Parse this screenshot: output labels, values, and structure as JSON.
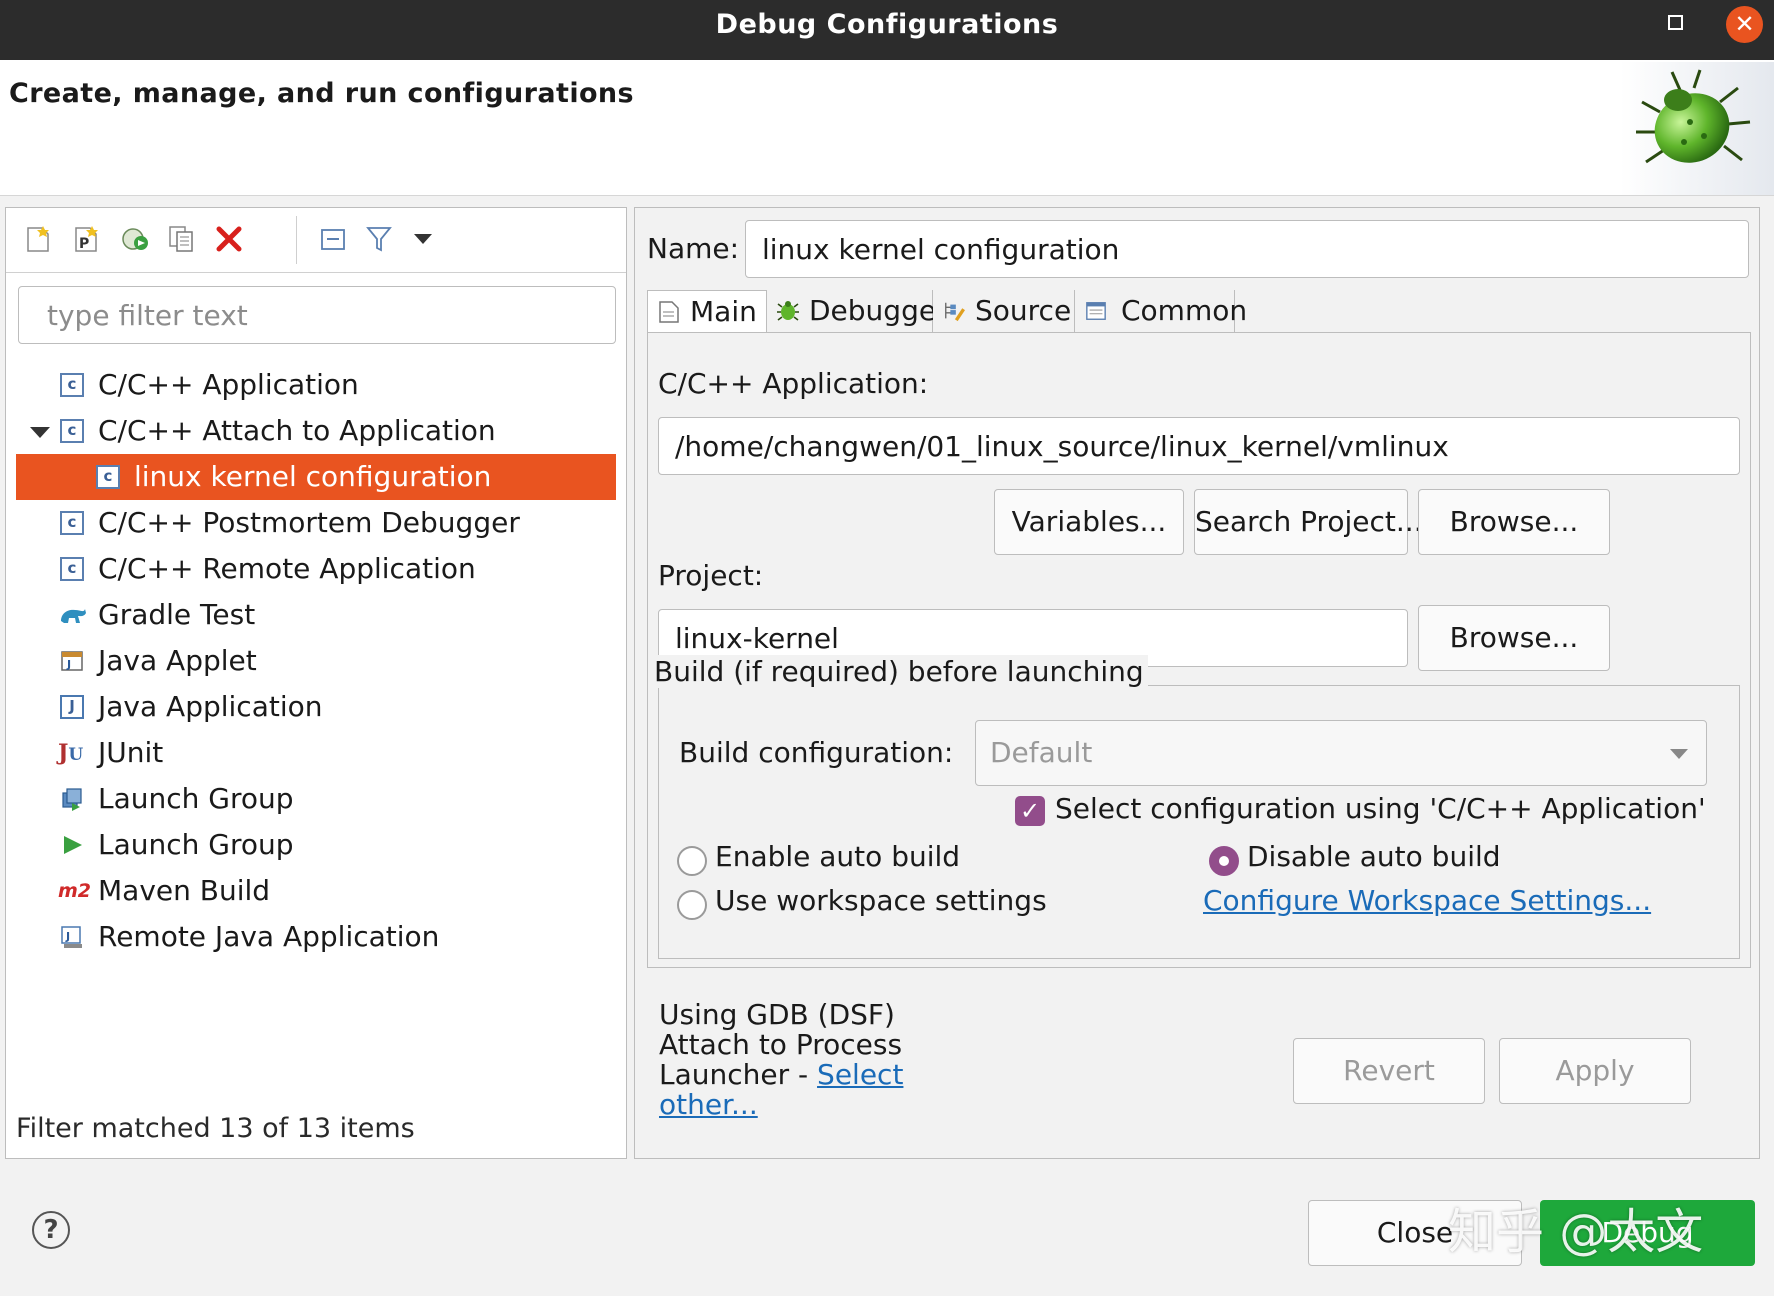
{
  "window": {
    "title": "Debug Configurations",
    "maximize_icon": "maximize-icon",
    "close_icon": "close-icon"
  },
  "header": {
    "heading": "Create, manage, and run configurations",
    "banner_icon": "bug-icon"
  },
  "toolbar": {
    "buttons": [
      "new-configuration-icon",
      "new-prototype-icon",
      "export-icon",
      "duplicate-icon",
      "delete-icon",
      "collapse-all-icon",
      "filter-icon",
      "view-menu-icon"
    ]
  },
  "filter": {
    "placeholder": "type filter text",
    "value": ""
  },
  "tree": {
    "items": [
      {
        "label": "C/C++ Application",
        "icon": "cpp-app-icon"
      },
      {
        "label": "C/C++ Attach to Application",
        "icon": "cpp-app-icon",
        "expanded": true
      },
      {
        "label": "linux kernel configuration",
        "icon": "cpp-app-icon",
        "selected": true
      },
      {
        "label": "C/C++ Postmortem Debugger",
        "icon": "cpp-app-icon"
      },
      {
        "label": "C/C++ Remote Application",
        "icon": "cpp-app-icon"
      },
      {
        "label": "Gradle Test",
        "icon": "gradle-icon"
      },
      {
        "label": "Java Applet",
        "icon": "java-applet-icon"
      },
      {
        "label": "Java Application",
        "icon": "java-app-icon"
      },
      {
        "label": "JUnit",
        "icon": "junit-icon"
      },
      {
        "label": "Launch Group",
        "icon": "launch-group-icon"
      },
      {
        "label": "Launch Group",
        "icon": "launch-group-play-icon"
      },
      {
        "label": "Maven Build",
        "icon": "maven-icon"
      },
      {
        "label": "Remote Java Application",
        "icon": "remote-java-icon"
      }
    ]
  },
  "status": {
    "filter_text": "Filter matched 13 of 13 items"
  },
  "config": {
    "name_label": "Name:",
    "name_value": "linux kernel configuration",
    "tabs": [
      {
        "label": "Main",
        "icon": "main-tab-icon",
        "active": true
      },
      {
        "label": "Debugger",
        "icon": "debugger-tab-icon"
      },
      {
        "label": "Source",
        "icon": "source-tab-icon"
      },
      {
        "label": "Common",
        "icon": "common-tab-icon"
      }
    ],
    "main": {
      "app_label": "C/C++ Application:",
      "app_value": "/home/changwen/01_linux_source/linux_kernel/vmlinux",
      "variables_button": "Variables...",
      "search_project_button": "Search Project...",
      "browse_app_button": "Browse...",
      "project_label": "Project:",
      "project_value": "linux-kernel",
      "browse_project_button": "Browse...",
      "build_group_label": "Build (if required) before launching",
      "build_config_label": "Build configuration:",
      "build_config_value": "Default",
      "select_config_label": "Select configuration using 'C/C++ Application'",
      "select_config_checked": true,
      "enable_auto_build": "Enable auto build",
      "disable_auto_build": "Disable auto build",
      "use_workspace": "Use workspace settings",
      "configure_workspace_link": "Configure Workspace Settings..."
    }
  },
  "launcher": {
    "line1": "Using GDB (DSF)",
    "line2": "Attach to Process",
    "line3_prefix": "Launcher - ",
    "select_link_part1": "Select",
    "select_link_part2": "other..."
  },
  "actions": {
    "revert": "Revert",
    "apply": "Apply",
    "close": "Close",
    "debug": "Debug",
    "help_icon": "help-icon"
  },
  "watermark": "知乎 @太文",
  "colors": {
    "selection": "#e95420",
    "debug_button": "#1ea83b",
    "checkbox": "#924d8b",
    "link": "#1a6bb8"
  }
}
